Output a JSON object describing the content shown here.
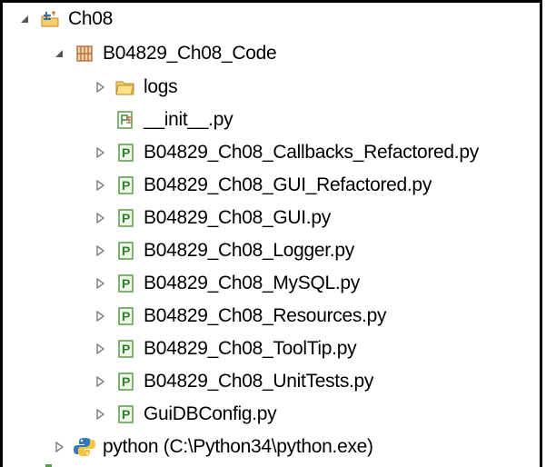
{
  "tree": {
    "project": {
      "label": "Ch08",
      "icon": "python-project-folder-icon",
      "expanded": true
    },
    "package": {
      "label": "B04829_Ch08_Code",
      "icon": "python-package-icon",
      "expanded": true
    },
    "items": [
      {
        "label": "logs",
        "icon": "folder-icon",
        "expandable": true
      },
      {
        "label": "__init__.py",
        "icon": "python-init-file-icon",
        "expandable": false
      },
      {
        "label": "B04829_Ch08_Callbacks_Refactored.py",
        "icon": "python-module-icon",
        "expandable": true
      },
      {
        "label": "B04829_Ch08_GUI_Refactored.py",
        "icon": "python-module-icon",
        "expandable": true
      },
      {
        "label": "B04829_Ch08_GUI.py",
        "icon": "python-module-icon",
        "expandable": true
      },
      {
        "label": "B04829_Ch08_Logger.py",
        "icon": "python-module-icon",
        "expandable": true
      },
      {
        "label": "B04829_Ch08_MySQL.py",
        "icon": "python-module-icon",
        "expandable": true
      },
      {
        "label": "B04829_Ch08_Resources.py",
        "icon": "python-module-icon",
        "expandable": true
      },
      {
        "label": "B04829_Ch08_ToolTip.py",
        "icon": "python-module-icon",
        "expandable": true
      },
      {
        "label": "B04829_Ch08_UnitTests.py",
        "icon": "python-module-icon",
        "expandable": true
      },
      {
        "label": "GuiDBConfig.py",
        "icon": "python-module-icon",
        "expandable": true
      }
    ],
    "interpreter": {
      "label": "python  (C:\\Python34\\python.exe)",
      "icon": "python-interpreter-icon",
      "expandable": true
    }
  },
  "colors": {
    "tree_twisty": "#7f7f7f",
    "python_file_icon": "#5a9a4a",
    "folder_fill": "#f5d06a",
    "package_icon": "#b5734d",
    "python_blue": "#3778b5",
    "python_yellow": "#f6c343"
  }
}
